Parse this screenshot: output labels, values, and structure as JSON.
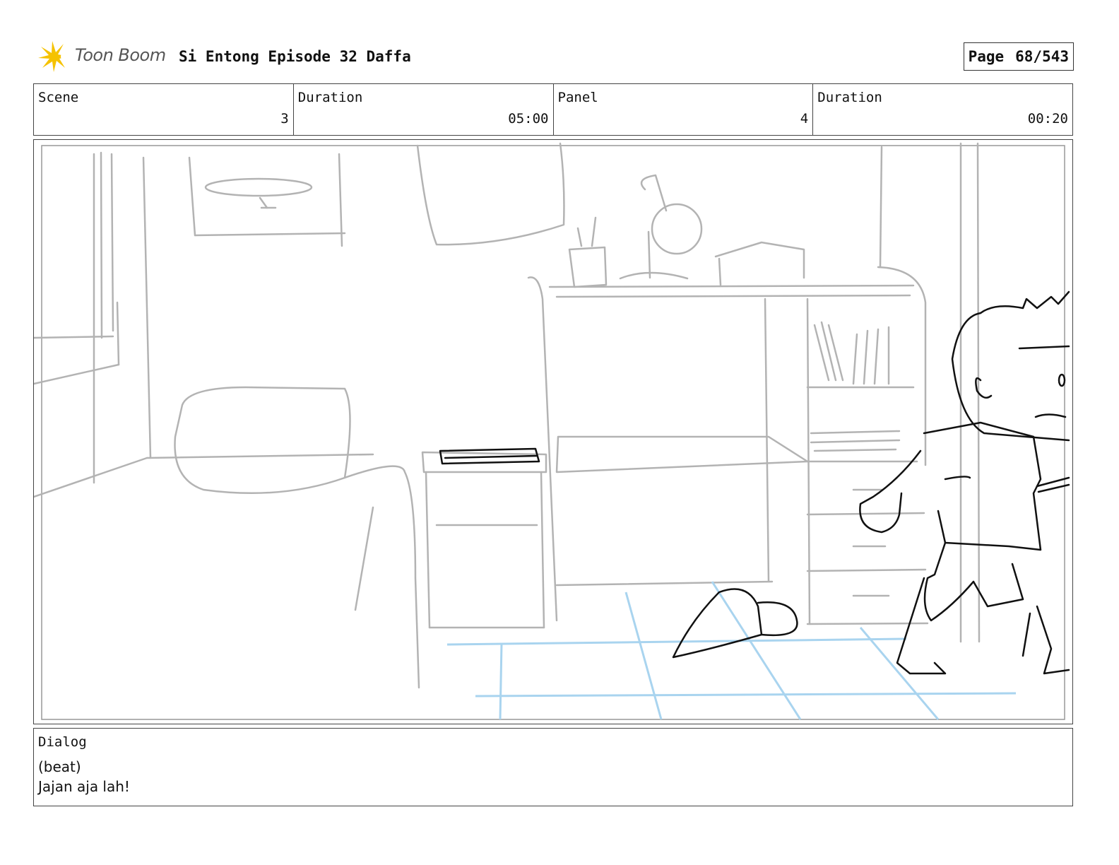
{
  "header": {
    "logo_text": "Toon Boom",
    "title": "Si Entong Episode 32 Daffa",
    "page_label": "Page",
    "page_value": "68/543"
  },
  "info": [
    {
      "label": "Scene",
      "value": "3"
    },
    {
      "label": "Duration",
      "value": "05:00"
    },
    {
      "label": "Panel",
      "value": "4"
    },
    {
      "label": "Duration",
      "value": "00:20"
    }
  ],
  "dialog": {
    "label": "Dialog",
    "lines": [
      "(beat)",
      "Jajan aja lah!"
    ]
  },
  "colors": {
    "sketch_gray": "#b3b3b3",
    "sketch_black": "#111111",
    "floor_blue": "#a9d4ef",
    "logo_yellow": "#f5c200"
  }
}
